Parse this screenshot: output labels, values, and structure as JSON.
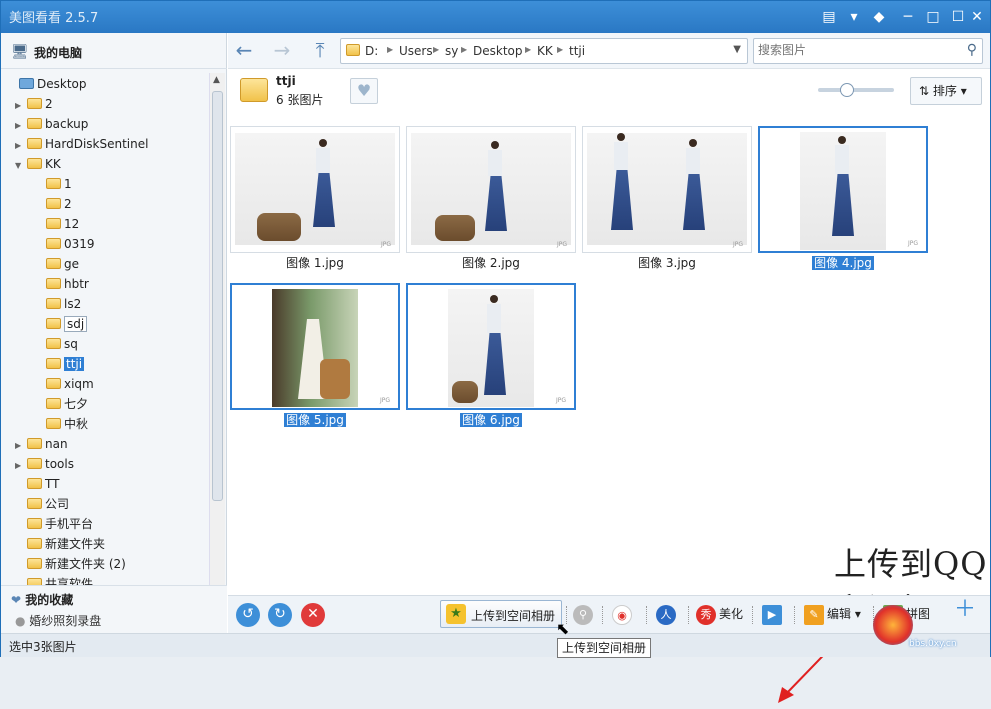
{
  "app": {
    "title": "美图看看 2.5.7",
    "controls": [
      "skin-icon",
      "menu-icon",
      "shirt-icon",
      "minimize-icon",
      "maximize-icon",
      "close-icon"
    ]
  },
  "sidebar": {
    "my_pc": "我的电脑",
    "tree": [
      {
        "label": "Desktop",
        "level": 0,
        "arrow": "",
        "icon": "desktop"
      },
      {
        "label": "2",
        "level": 1,
        "arrow": "▶"
      },
      {
        "label": "backup",
        "level": 1,
        "arrow": "▶"
      },
      {
        "label": "HardDiskSentinel",
        "level": 1,
        "arrow": "▶"
      },
      {
        "label": "KK",
        "level": 1,
        "arrow": "▼"
      },
      {
        "label": "1",
        "level": 2,
        "arrow": ""
      },
      {
        "label": "2",
        "level": 2,
        "arrow": ""
      },
      {
        "label": "12",
        "level": 2,
        "arrow": ""
      },
      {
        "label": "0319",
        "level": 2,
        "arrow": ""
      },
      {
        "label": "ge",
        "level": 2,
        "arrow": ""
      },
      {
        "label": "hbtr",
        "level": 2,
        "arrow": ""
      },
      {
        "label": "ls2",
        "level": 2,
        "arrow": ""
      },
      {
        "label": "sdj",
        "level": 2,
        "arrow": "",
        "box": true
      },
      {
        "label": "sq",
        "level": 2,
        "arrow": ""
      },
      {
        "label": "ttji",
        "level": 2,
        "arrow": "",
        "selected": true
      },
      {
        "label": "xiqm",
        "level": 2,
        "arrow": ""
      },
      {
        "label": "七夕",
        "level": 2,
        "arrow": ""
      },
      {
        "label": "中秋",
        "level": 2,
        "arrow": ""
      },
      {
        "label": "nan",
        "level": 1,
        "arrow": "▶"
      },
      {
        "label": "tools",
        "level": 1,
        "arrow": "▶"
      },
      {
        "label": "TT",
        "level": 1,
        "arrow": ""
      },
      {
        "label": "公司",
        "level": 1,
        "arrow": ""
      },
      {
        "label": "手机平台",
        "level": 1,
        "arrow": ""
      },
      {
        "label": "新建文件夹",
        "level": 1,
        "arrow": ""
      },
      {
        "label": "新建文件夹 (2)",
        "level": 1,
        "arrow": ""
      },
      {
        "label": "共享软件",
        "level": 1,
        "arrow": ""
      }
    ],
    "favorites_title": "我的收藏",
    "favorites_item": "婚纱照刻录盘"
  },
  "nav": {
    "path": [
      "D:",
      "Users",
      "sy",
      "Desktop",
      "KK",
      "ttji"
    ],
    "search_placeholder": "搜索图片"
  },
  "folder": {
    "name": "ttji",
    "count": "6 张图片"
  },
  "sort_label": "排序",
  "photos": [
    {
      "caption": "图像 1.jpg",
      "selected": false
    },
    {
      "caption": "图像 2.jpg",
      "selected": false
    },
    {
      "caption": "图像 3.jpg",
      "selected": false
    },
    {
      "caption": "图像 4.jpg",
      "selected": true
    },
    {
      "caption": "图像 5.jpg",
      "selected": true
    },
    {
      "caption": "图像 6.jpg",
      "selected": true
    }
  ],
  "jpg_tag": "JPG",
  "annotation": "上传到QQ空间相册",
  "toolbar": {
    "upload_label": "上传到空间相册",
    "beautify_label": "美化",
    "edit_label": "编辑",
    "collage_label": "拼图"
  },
  "tooltip": "上传到空间相册",
  "status": "选中3张图片",
  "watermark_site": "bbs.0xy.cn",
  "colors": {
    "accent": "#2f7fd4",
    "titlebar": "#2a78c4",
    "annotation_arrow": "#e02020"
  }
}
